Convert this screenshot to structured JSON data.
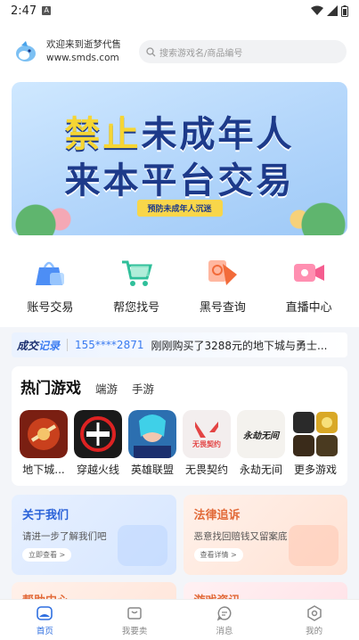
{
  "status": {
    "time": "2:47",
    "notif_icon": "a-icon"
  },
  "header": {
    "welcome": "欢迎来到逝梦代售",
    "url": "www.smds.com",
    "search_placeholder": "搜索游戏名/商品编号"
  },
  "banner": {
    "line1_hl": "禁止",
    "line1_rest": "未成年人",
    "line2": "来本平台交易",
    "ribbon": "预防未成年人沉迷"
  },
  "quick": [
    {
      "label": "账号交易",
      "icon": "bag-icon"
    },
    {
      "label": "帮您找号",
      "icon": "cart-icon"
    },
    {
      "label": "黑号查询",
      "icon": "search-doc-icon"
    },
    {
      "label": "直播中心",
      "icon": "video-icon"
    }
  ],
  "ticker": {
    "label_a": "成交",
    "label_b": "记录",
    "phone": "155****2871",
    "message": "刚刚购买了3288元的地下城与勇士..."
  },
  "hot": {
    "title": "热门游戏",
    "tabs": [
      "端游",
      "手游"
    ],
    "games": [
      {
        "name": "地下城...",
        "icon": "dnf-icon"
      },
      {
        "name": "穿越火线",
        "icon": "cf-icon"
      },
      {
        "name": "英雄联盟",
        "icon": "lol-icon"
      },
      {
        "name": "无畏契约",
        "icon": "valorant-icon",
        "icon_text": "无畏契约"
      },
      {
        "name": "永劫无间",
        "icon": "naraka-icon",
        "icon_text": "永劫无间"
      },
      {
        "name": "更多游戏",
        "icon": "more-games-icon"
      }
    ]
  },
  "cards": [
    {
      "title": "关于我们",
      "subtitle": "请进一步了解我们吧",
      "button": "立即查看 >"
    },
    {
      "title": "法律追诉",
      "subtitle": "恶意找回赔钱又留案底",
      "button": "查看详情 >"
    }
  ],
  "cards2": [
    {
      "title": "帮助中心"
    },
    {
      "title": "游戏资讯"
    }
  ],
  "tabbar": [
    {
      "label": "首页",
      "icon": "home-icon",
      "active": true
    },
    {
      "label": "我要卖",
      "icon": "sell-icon",
      "active": false
    },
    {
      "label": "消息",
      "icon": "message-icon",
      "active": false
    },
    {
      "label": "我的",
      "icon": "profile-icon",
      "active": false
    }
  ],
  "colors": {
    "accent": "#2f6fe0",
    "banner_text": "#1d3a8a",
    "highlight": "#f6d533",
    "orange": "#e26b3a"
  }
}
